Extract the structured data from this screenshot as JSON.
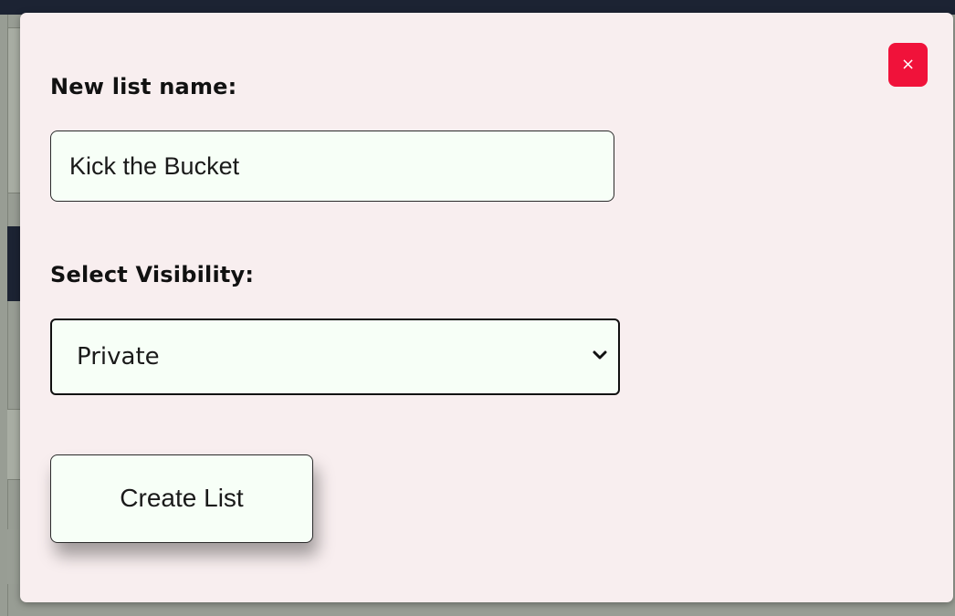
{
  "modal": {
    "close_glyph": "×",
    "close_icon": "close-icon",
    "name_label": "New list name:",
    "name_value": "Kick the Bucket",
    "visibility_label": "Select Visibility:",
    "visibility_selected": "Private",
    "dropdown_icon": "chevron-down-icon",
    "submit_label": "Create List"
  },
  "colors": {
    "close_button": "#f0123a",
    "modal_background": "#f8eeef",
    "field_background": "#f7fff7",
    "overlay_dark": "#1c2333"
  }
}
